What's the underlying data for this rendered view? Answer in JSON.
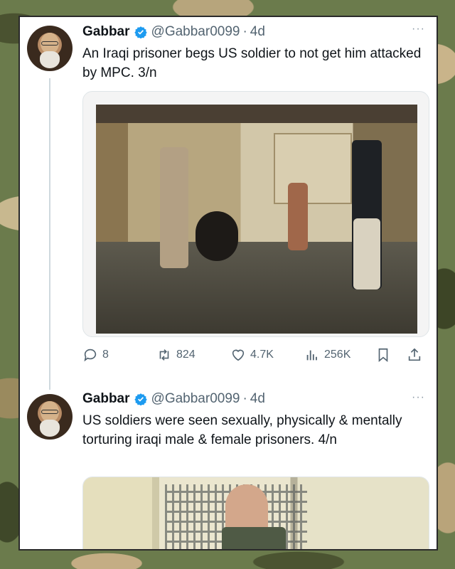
{
  "colors": {
    "verified_badge": "#1d9bf0",
    "text_primary": "#0f1419",
    "text_secondary": "#536471"
  },
  "tweets": [
    {
      "name": "Gabbar",
      "handle": "@Gabbar0099",
      "dot": "·",
      "time": "4d",
      "more": "···",
      "text": "An Iraqi prisoner begs US soldier to not get him attacked by MPC. 3/n",
      "stats": {
        "replies": "8",
        "reposts": "824",
        "likes": "4.7K",
        "views": "256K"
      },
      "icons": [
        "reply-icon",
        "repost-icon",
        "like-icon",
        "views-icon",
        "bookmark-icon",
        "share-icon"
      ]
    },
    {
      "name": "Gabbar",
      "handle": "@Gabbar0099",
      "dot": "·",
      "time": "4d",
      "more": "···",
      "text": "US soldiers were seen sexually, physically & mentally torturing iraqi male & female prisoners. 4/n"
    }
  ]
}
